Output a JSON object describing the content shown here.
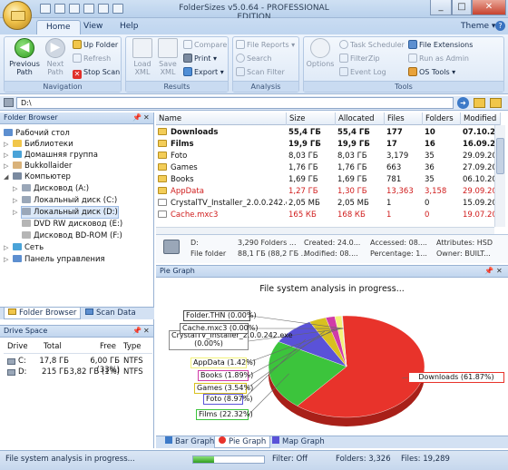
{
  "window": {
    "title": "FolderSizes v5.0.64 - PROFESSIONAL EDITION",
    "theme_label": "Theme",
    "help_icon": "?"
  },
  "tabs": [
    "Home",
    "View",
    "Help"
  ],
  "ribbon": {
    "navigation": {
      "label": "Navigation",
      "previous": "Previous Path",
      "next": "Next Path",
      "up": "Up Folder",
      "refresh": "Refresh",
      "stop": "Stop Scan"
    },
    "results": {
      "label": "Results",
      "load": "Load XML",
      "save": "Save XML",
      "compare": "Compare",
      "print": "Print",
      "export": "Export"
    },
    "analysis": {
      "label": "Analysis",
      "file_reports": "File Reports",
      "search": "Search",
      "scan_filter": "Scan Filter"
    },
    "tools": {
      "label": "Tools",
      "options": "Options",
      "task_scheduler": "Task Scheduler",
      "filterzip": "FilterZip",
      "event_log": "Event Log",
      "file_extensions": "File Extensions",
      "run_as_admin": "Run as Admin",
      "os_tools": "OS Tools"
    }
  },
  "address": {
    "value": "D:\\"
  },
  "folder_browser": {
    "title": "Folder Browser",
    "items": [
      "Рабочий стол",
      "Библиотеки",
      "Домашняя группа",
      "Bukkollaider",
      "Компьютер",
      "Дисковод (A:)",
      "Локальный диск (C:)",
      "Локальный диск (D:)",
      "DVD RW дисковод (E:)",
      "Дисковод BD-ROM (F:)",
      "Сеть",
      "Панель управления"
    ],
    "tabs": [
      "Folder Browser",
      "Scan Data"
    ]
  },
  "drive_space": {
    "title": "Drive Space",
    "columns": [
      "Drive",
      "Total",
      "Free",
      "Type"
    ],
    "rows": [
      {
        "drive": "C:",
        "total": "17,8 ГБ",
        "free": "6,00 ГБ (33%)",
        "type": "NTFS"
      },
      {
        "drive": "D:",
        "total": "215 ГБ",
        "free": "3,82 ГБ (1%)",
        "type": "NTFS"
      }
    ]
  },
  "file_list": {
    "columns": [
      "Name",
      "Size",
      "Allocated",
      "Files",
      "Folders",
      "Modified"
    ],
    "rows": [
      {
        "name": "Downloads",
        "size": "55,4 ГБ",
        "allocated": "55,4 ГБ",
        "files": "177",
        "folders": "10",
        "modified": "07.10.201",
        "bold": true,
        "red": false,
        "kind": "folder"
      },
      {
        "name": "Films",
        "size": "19,9 ГБ",
        "allocated": "19,9 ГБ",
        "files": "17",
        "folders": "16",
        "modified": "16.09.201",
        "bold": true,
        "red": false,
        "kind": "folder"
      },
      {
        "name": "Foto",
        "size": "8,03 ГБ",
        "allocated": "8,03 ГБ",
        "files": "3,179",
        "folders": "35",
        "modified": "29.09.201",
        "bold": false,
        "red": false,
        "kind": "folder"
      },
      {
        "name": "Games",
        "size": "1,76 ГБ",
        "allocated": "1,76 ГБ",
        "files": "663",
        "folders": "36",
        "modified": "27.09.201",
        "bold": false,
        "red": false,
        "kind": "folder"
      },
      {
        "name": "Books",
        "size": "1,69 ГБ",
        "allocated": "1,69 ГБ",
        "files": "781",
        "folders": "35",
        "modified": "06.10.201",
        "bold": false,
        "red": false,
        "kind": "folder"
      },
      {
        "name": "AppData",
        "size": "1,27 ГБ",
        "allocated": "1,30 ГБ",
        "files": "13,363",
        "folders": "3,158",
        "modified": "29.09.201",
        "bold": false,
        "red": true,
        "kind": "folder"
      },
      {
        "name": "CrystalTV_Installer_2.0.0.242.exe",
        "size": "2,05 МБ",
        "allocated": "2,05 МБ",
        "files": "1",
        "folders": "0",
        "modified": "15.09.201",
        "bold": false,
        "red": false,
        "kind": "file"
      },
      {
        "name": "Cache.mxc3",
        "size": "165 КБ",
        "allocated": "168 КБ",
        "files": "1",
        "folders": "0",
        "modified": "19.07.201",
        "bold": false,
        "red": true,
        "kind": "file"
      }
    ]
  },
  "details": {
    "name": "D:",
    "type": "File folder",
    "folders": "3,290 Folders ...",
    "size": "88,1 ГБ (88,2 ГБ ...",
    "created": "Created: 24.0...",
    "modified": "Modified: 08....",
    "accessed": "Accessed: 08....",
    "percentage": "Percentage: 1...",
    "attributes": "Attributes: HSD",
    "owner": "Owner: BUILT..."
  },
  "pie": {
    "panel_title": "Pie Graph",
    "title": "File system analysis in progress...",
    "tabs": [
      "Bar Graph",
      "Pie Graph",
      "Map Graph"
    ]
  },
  "chart_data": {
    "type": "pie",
    "title": "File system analysis in progress...",
    "slices": [
      {
        "label": "Downloads (61.87%)",
        "value": 61.87,
        "color": "#e8332b"
      },
      {
        "label": "Films (22.32%)",
        "value": 22.32,
        "color": "#3cc43c"
      },
      {
        "label": "Foto (8.97%)",
        "value": 8.97,
        "color": "#5a52d8"
      },
      {
        "label": "Games (3.54%)",
        "value": 3.54,
        "color": "#d8c020"
      },
      {
        "label": "Books (1.89%)",
        "value": 1.89,
        "color": "#d03ca8"
      },
      {
        "label": "AppData (1.42%)",
        "value": 1.42,
        "color": "#f2f27a"
      },
      {
        "label": "CrystalTV_Installer_2.0.0.242.exe (0.00%)",
        "value": 0.0,
        "color": "#8a8a8a"
      },
      {
        "label": "Cache.mxc3 (0.00%)",
        "value": 0.0,
        "color": "#6a6a6a"
      },
      {
        "label": "Folder.THN (0.00%)",
        "value": 0.0,
        "color": "#4a4a4a"
      }
    ]
  },
  "status": {
    "message": "File system analysis in progress...",
    "filter": "Filter: Off",
    "folders": "Folders: 3,326",
    "files": "Files: 19,289"
  },
  "colors": {
    "accent": "#1e5a9e",
    "red_text": "#d01c1c"
  }
}
